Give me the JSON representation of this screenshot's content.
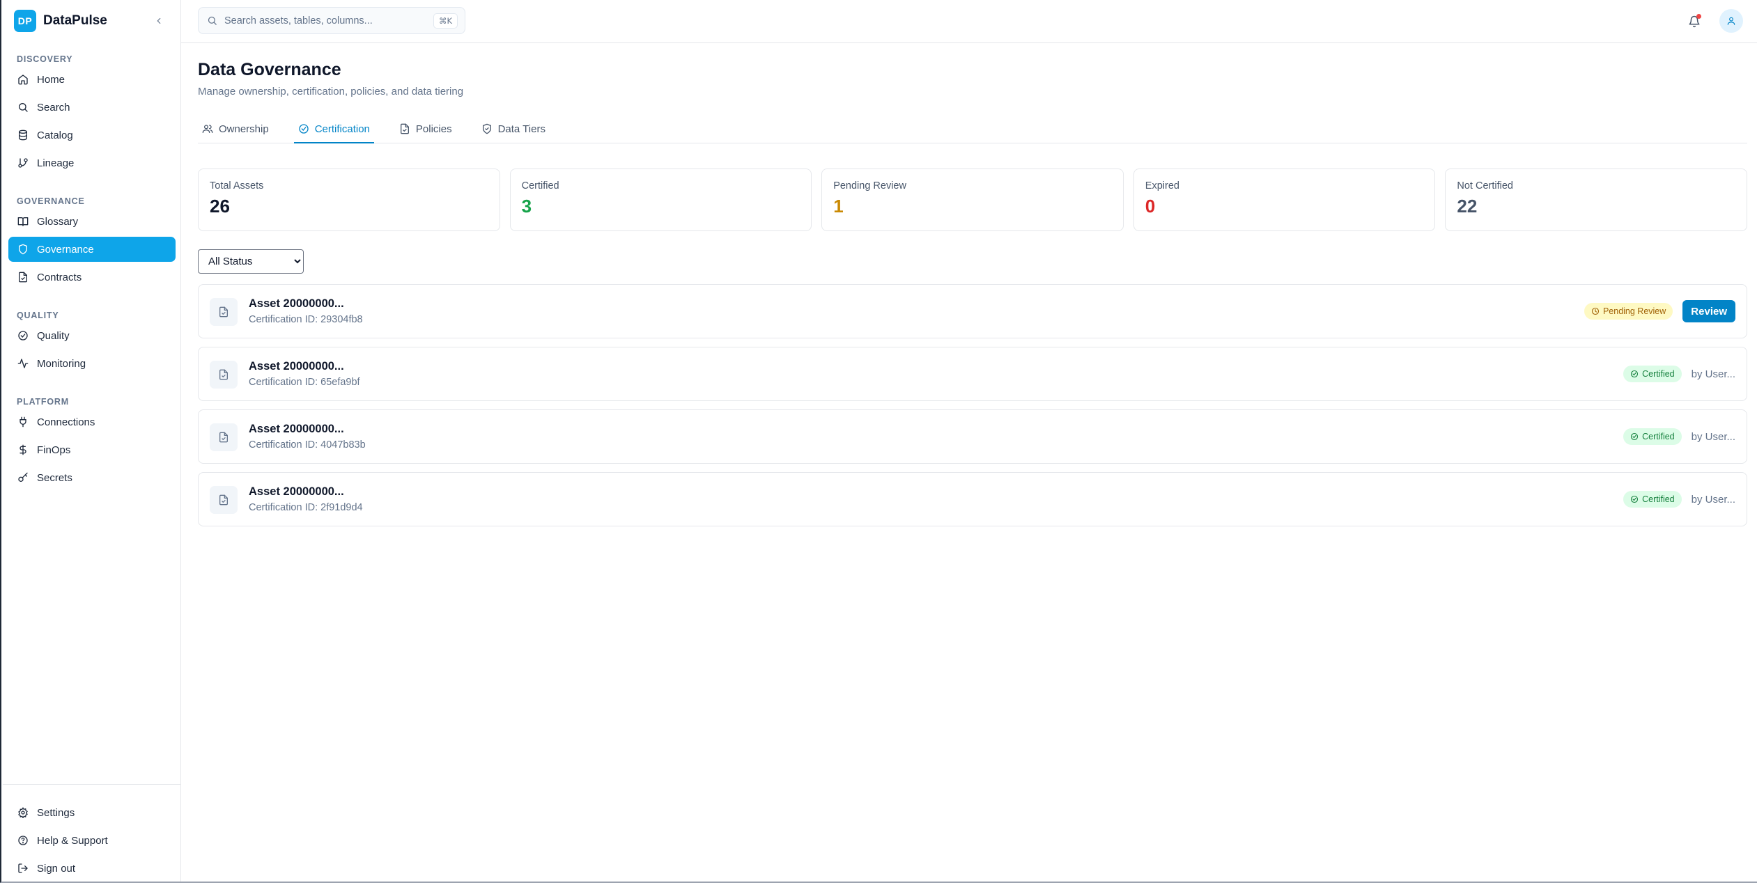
{
  "brand": {
    "logo": "DP",
    "name": "DataPulse"
  },
  "colors": {
    "accent": "#0ea5e9",
    "primary_button": "#0284c7",
    "certified": "#16a34a",
    "pending": "#ca8a04",
    "expired": "#dc2626",
    "not_certified": "#475569"
  },
  "sidebar": {
    "sections": [
      {
        "heading": "DISCOVERY",
        "items": [
          {
            "label": "Home",
            "icon": "home-icon"
          },
          {
            "label": "Search",
            "icon": "search-icon"
          },
          {
            "label": "Catalog",
            "icon": "database-icon"
          },
          {
            "label": "Lineage",
            "icon": "git-branch-icon"
          }
        ]
      },
      {
        "heading": "GOVERNANCE",
        "items": [
          {
            "label": "Glossary",
            "icon": "book-icon"
          },
          {
            "label": "Governance",
            "icon": "shield-icon",
            "active": true
          },
          {
            "label": "Contracts",
            "icon": "file-check-icon"
          }
        ]
      },
      {
        "heading": "QUALITY",
        "items": [
          {
            "label": "Quality",
            "icon": "check-circle-icon"
          },
          {
            "label": "Monitoring",
            "icon": "activity-icon"
          }
        ]
      },
      {
        "heading": "PLATFORM",
        "items": [
          {
            "label": "Connections",
            "icon": "plug-icon"
          },
          {
            "label": "FinOps",
            "icon": "dollar-icon"
          },
          {
            "label": "Secrets",
            "icon": "key-icon"
          }
        ]
      }
    ],
    "bottom": [
      {
        "label": "Settings",
        "icon": "gear-icon"
      },
      {
        "label": "Help & Support",
        "icon": "help-circle-icon"
      },
      {
        "label": "Sign out",
        "icon": "sign-out-icon"
      }
    ]
  },
  "search": {
    "placeholder": "Search assets, tables, columns...",
    "value": "",
    "shortcut": "⌘K"
  },
  "page": {
    "title": "Data Governance",
    "subtitle": "Manage ownership, certification, policies, and data tiering"
  },
  "tabs": [
    {
      "label": "Ownership",
      "icon": "users-icon"
    },
    {
      "label": "Certification",
      "icon": "check-circle-icon",
      "active": true
    },
    {
      "label": "Policies",
      "icon": "file-check-icon"
    },
    {
      "label": "Data Tiers",
      "icon": "shield-check-icon"
    }
  ],
  "stats": [
    {
      "label": "Total Assets",
      "value": "26",
      "color": "#0f172a"
    },
    {
      "label": "Certified",
      "value": "3",
      "color": "#16a34a"
    },
    {
      "label": "Pending Review",
      "value": "1",
      "color": "#ca8a04"
    },
    {
      "label": "Expired",
      "value": "0",
      "color": "#dc2626"
    },
    {
      "label": "Not Certified",
      "value": "22",
      "color": "#475569"
    }
  ],
  "filter": {
    "selected": "All Status"
  },
  "certifications": [
    {
      "name": "Asset 20000000...",
      "id_text": "Certification ID: 29304fb8",
      "status": "Pending Review",
      "status_type": "pending",
      "action": "Review"
    },
    {
      "name": "Asset 20000000...",
      "id_text": "Certification ID: 65efa9bf",
      "status": "Certified",
      "status_type": "certified",
      "by": "by User..."
    },
    {
      "name": "Asset 20000000...",
      "id_text": "Certification ID: 4047b83b",
      "status": "Certified",
      "status_type": "certified",
      "by": "by User..."
    },
    {
      "name": "Asset 20000000...",
      "id_text": "Certification ID: 2f91d9d4",
      "status": "Certified",
      "status_type": "certified",
      "by": "by User..."
    }
  ]
}
